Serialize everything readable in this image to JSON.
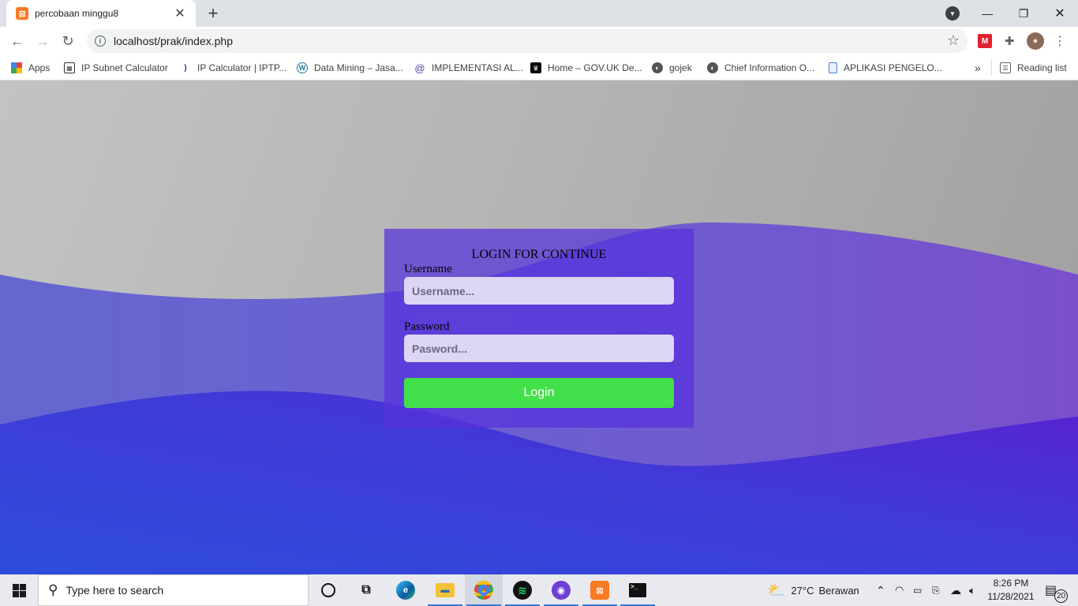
{
  "browser": {
    "tab": {
      "title": "percobaan minggu8",
      "close": "✕"
    },
    "new_tab": "+",
    "url": "localhost/prak/index.php",
    "window_controls": {
      "minimize": "—",
      "restore": "❐",
      "close": "✕"
    }
  },
  "bookmarks": [
    {
      "label": "Apps",
      "icon": "apps-grid-icon"
    },
    {
      "label": "IP Subnet Calculator",
      "icon": "calculator-icon"
    },
    {
      "label": "IP Calculator | IPTP...",
      "icon": "iptp-icon"
    },
    {
      "label": "Data Mining – Jasa...",
      "icon": "wordpress-icon"
    },
    {
      "label": "IMPLEMENTASI AL...",
      "icon": "at-icon"
    },
    {
      "label": "Home – GOV.UK De...",
      "icon": "crown-icon"
    },
    {
      "label": "gojek",
      "icon": "globe-icon"
    },
    {
      "label": "Chief Information O...",
      "icon": "globe-icon"
    },
    {
      "label": "APLIKASI PENGELO...",
      "icon": "document-icon"
    }
  ],
  "bookmarks_overflow": "»",
  "reading_list": "Reading list",
  "login": {
    "title": "LOGIN FOR CONTINUE",
    "username_label": "Username",
    "username_placeholder": "Username...",
    "password_label": "Password",
    "password_placeholder": "Pasword...",
    "button": "Login"
  },
  "taskbar": {
    "search_placeholder": "Type here to search",
    "weather_temp": "27°C",
    "weather_desc": "Berawan",
    "time": "8:26 PM",
    "date": "11/28/2021",
    "notification_count": "20"
  },
  "colors": {
    "card": "#5630dc",
    "button": "#42e04a",
    "input": "#ddd5f5",
    "wave_top": "#6b5fd0",
    "wave_bottom": "#3a3fd8"
  }
}
